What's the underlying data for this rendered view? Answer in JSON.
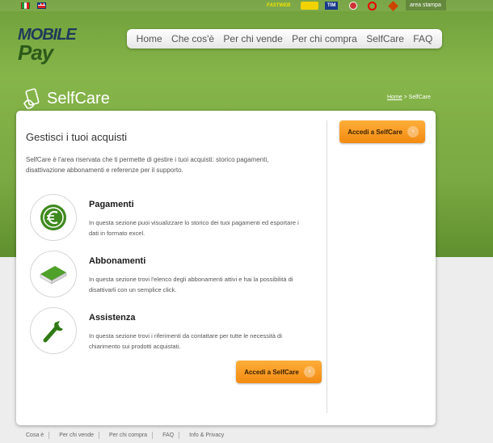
{
  "top": {
    "partners": [
      "FASTWEB",
      "TIM"
    ],
    "area_stampa": "area stampa"
  },
  "logo": {
    "line1": "MOBILE",
    "line2": "Pay"
  },
  "nav": {
    "items": [
      "Home",
      "Che cos'è",
      "Per chi vende",
      "Per chi compra",
      "SelfCare",
      "FAQ"
    ]
  },
  "section": {
    "title": "SelfCare"
  },
  "breadcrumb": {
    "home": "Home",
    "sep": " > ",
    "current": "SelfCare"
  },
  "panel": {
    "title": "Gestisci i tuoi acquisti",
    "intro": "SelfCare è l'area riservata che ti permette di gestire i tuoi acquisti: storico pagamenti, disattivazione abbonamenti e referenze per il supporto.",
    "cta": "Accedi a SelfCare",
    "cta_arrow": "›",
    "features": [
      {
        "title": "Pagamenti",
        "desc": "In questa sezione puoi visualizzare lo storico dei tuoi pagamenti ed esportare i dati in formato excel.",
        "icon": "euro-icon"
      },
      {
        "title": "Abbonamenti",
        "desc": "In questa sezione trovi l'elenco degli abbonamenti attivi e hai la possibilità di disattivarli con un semplice click.",
        "icon": "book-icon"
      },
      {
        "title": "Assistenza",
        "desc": "In questa sezione trovi i riferimenti da contattare per tutte le necessità di chiarimento sui prodotti acquistati.",
        "icon": "wrench-icon"
      }
    ]
  },
  "footer": {
    "links": [
      "Cosa è",
      "Per chi vende",
      "Per chi compra",
      "FAQ",
      "Info & Privacy"
    ]
  },
  "colors": {
    "green": "#7aa842",
    "orange": "#f28a10",
    "icon_green": "#3f8a1e"
  }
}
